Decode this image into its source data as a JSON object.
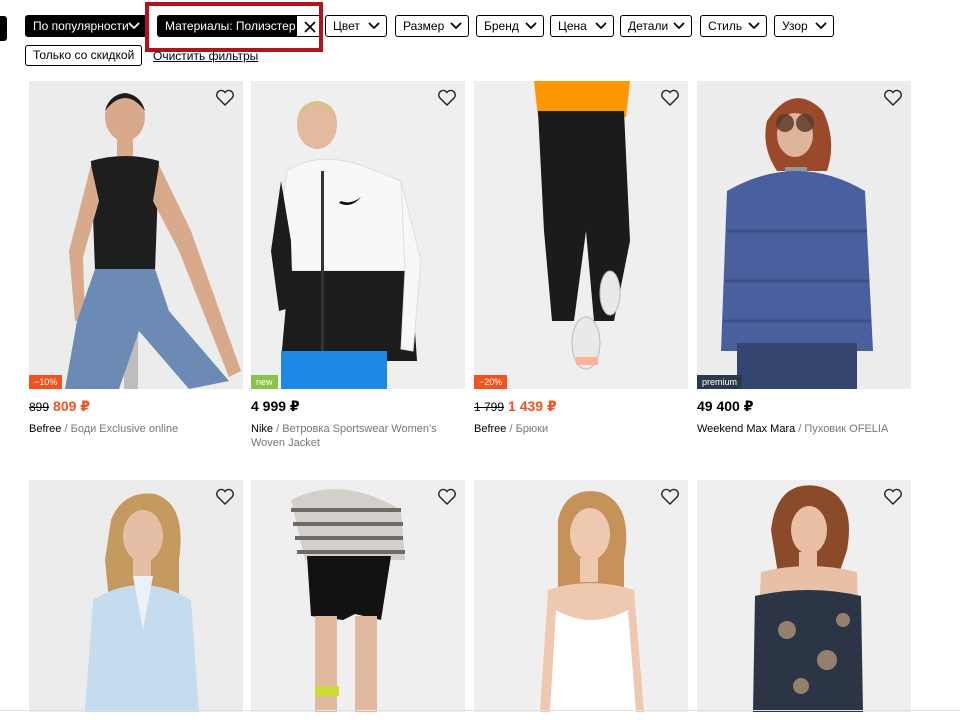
{
  "filters": {
    "sort_label": "По популярности",
    "material_label": "Материалы: Полиэстер",
    "chips": [
      "Цвет",
      "Размер",
      "Бренд",
      "Цена",
      "Детали",
      "Стиль",
      "Узор"
    ],
    "discount_label": "Только со скидкой",
    "clear_label": "Очистить фильтры"
  },
  "products": [
    {
      "badge": "−10%",
      "badge_type": "sale",
      "price_old": "899",
      "price": "809 ₽",
      "brand": "Befree",
      "name": "Боди Exclusive online"
    },
    {
      "badge": "new",
      "badge_type": "new",
      "price_old": "",
      "price": "4 999 ₽",
      "brand": "Nike",
      "name": "Ветровка Sportswear Women's Woven Jacket"
    },
    {
      "badge": "−20%",
      "badge_type": "sale",
      "price_old": "1 799",
      "price": "1 439 ₽",
      "brand": "Befree",
      "name": "Брюки"
    },
    {
      "badge": "premium",
      "badge_type": "premium",
      "price_old": "",
      "price": "49 400 ₽",
      "brand": "Weekend Max Mara",
      "name": "Пуховик OFELIA"
    }
  ],
  "colors": {
    "accent": "#f4511e",
    "highlight": "#b3111d",
    "new_badge": "#8bc34a",
    "premium_badge": "#2b3a4a"
  }
}
